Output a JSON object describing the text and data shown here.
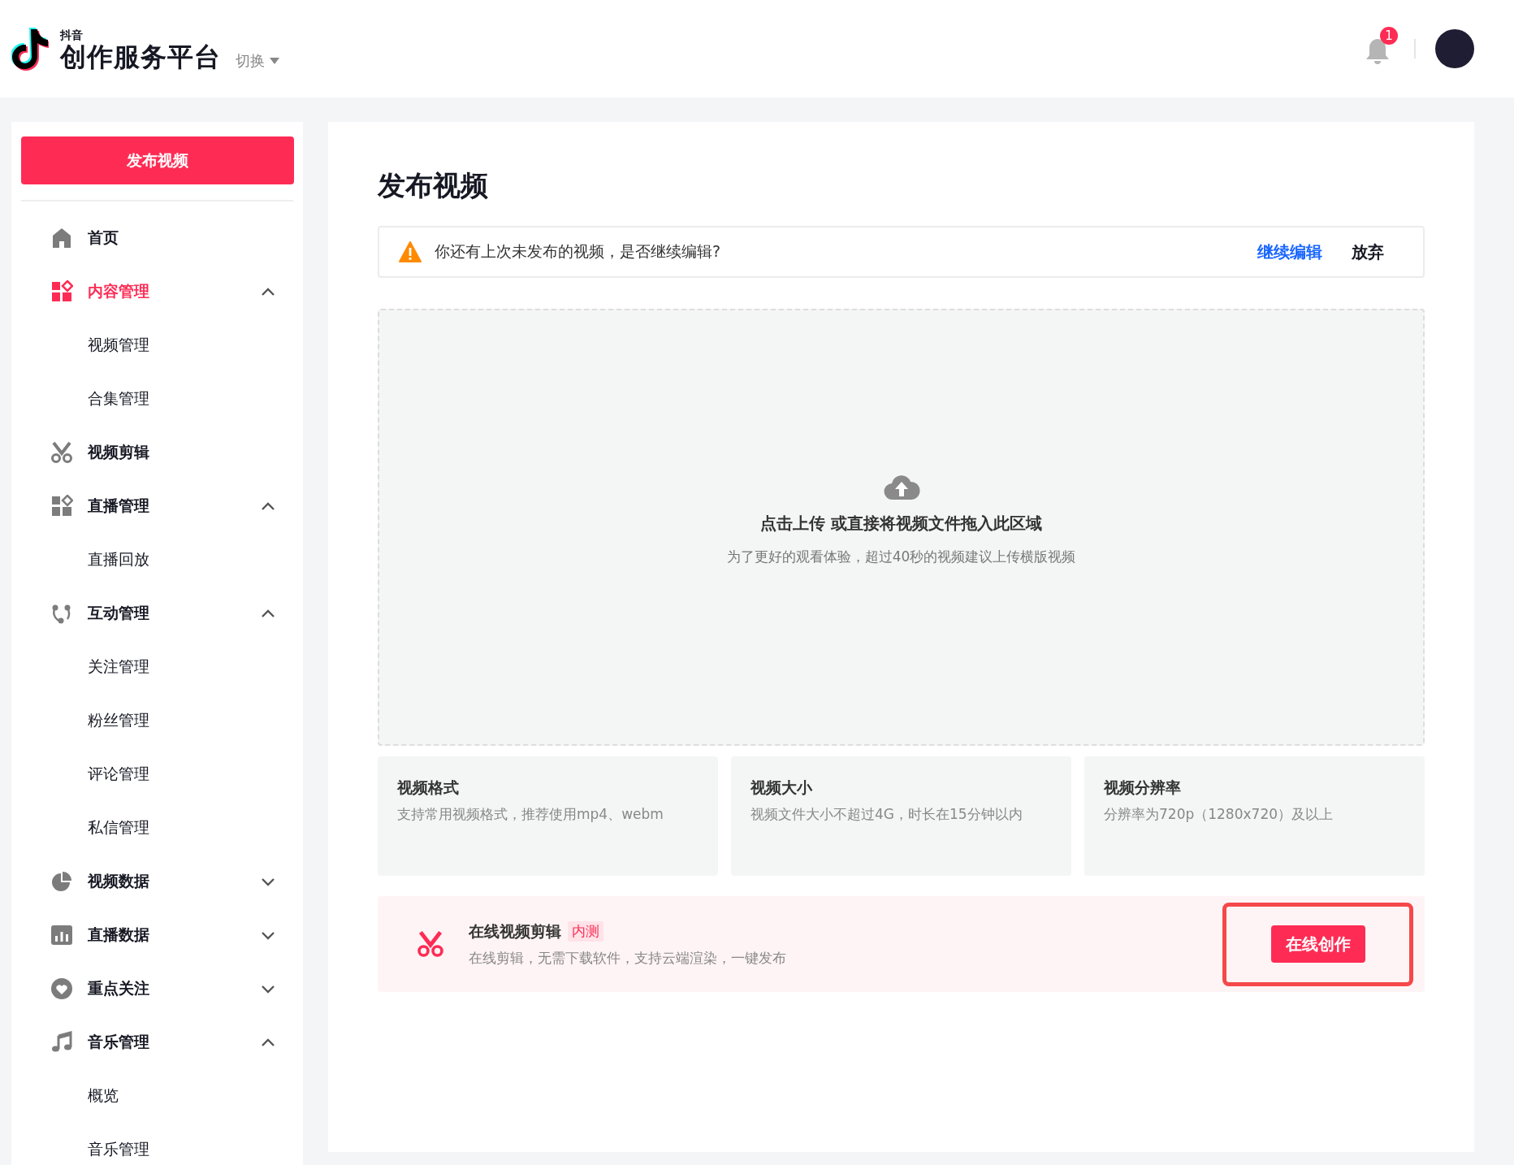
{
  "header": {
    "logo_small": "抖音",
    "logo_title": "创作服务平台",
    "switch": "切换",
    "notification_badge": "1"
  },
  "sidebar": {
    "publish_button": "发布视频",
    "items": [
      {
        "label": "首页",
        "kind": "link",
        "selected": false
      },
      {
        "label": "内容管理",
        "kind": "group",
        "selected": true,
        "expanded": true,
        "children": [
          {
            "label": "视频管理",
            "selected": false
          },
          {
            "label": "合集管理",
            "selected": false
          }
        ]
      },
      {
        "label": "视频剪辑",
        "kind": "link",
        "selected": false
      },
      {
        "label": "直播管理",
        "kind": "group",
        "selected": false,
        "expanded": true,
        "children": [
          {
            "label": "直播回放",
            "selected": false
          }
        ]
      },
      {
        "label": "互动管理",
        "kind": "group",
        "selected": false,
        "expanded": true,
        "children": [
          {
            "label": "关注管理",
            "selected": false
          },
          {
            "label": "粉丝管理",
            "selected": false
          },
          {
            "label": "评论管理",
            "selected": false
          },
          {
            "label": "私信管理",
            "selected": false
          }
        ]
      },
      {
        "label": "视频数据",
        "kind": "group",
        "selected": false,
        "expanded": false
      },
      {
        "label": "直播数据",
        "kind": "group",
        "selected": false,
        "expanded": false
      },
      {
        "label": "重点关注",
        "kind": "group",
        "selected": false,
        "expanded": false
      },
      {
        "label": "音乐管理",
        "kind": "group",
        "selected": false,
        "expanded": true,
        "children": [
          {
            "label": "概览",
            "selected": false
          },
          {
            "label": "音乐管理",
            "selected": false
          }
        ]
      }
    ]
  },
  "main": {
    "title": "发布视频",
    "alert": {
      "message": "你还有上次未发布的视频，是否继续编辑?",
      "actions": [
        {
          "label": "继续编辑",
          "kind": "primary"
        },
        {
          "label": "放弃",
          "kind": "plain"
        }
      ]
    },
    "upload": {
      "heading": "点击上传 或直接将视频文件拖入此区域",
      "hint": "为了更好的观看体验，超过40秒的视频建议上传横版视频"
    },
    "requirements": [
      {
        "title": "视频格式",
        "description": "支持常用视频格式，推荐使用mp4、webm"
      },
      {
        "title": "视频大小",
        "description": "视频文件大小不超过4G，时长在15分钟以内"
      },
      {
        "title": "视频分辨率",
        "description": "分辨率为720p（1280x720）及以上"
      }
    ],
    "online_editor": {
      "title": "在线视频剪辑",
      "tag": "内测",
      "description": "在线剪辑，无需下载软件，支持云端渲染，一键发布",
      "button": "在线创作",
      "highlighted": true
    }
  }
}
